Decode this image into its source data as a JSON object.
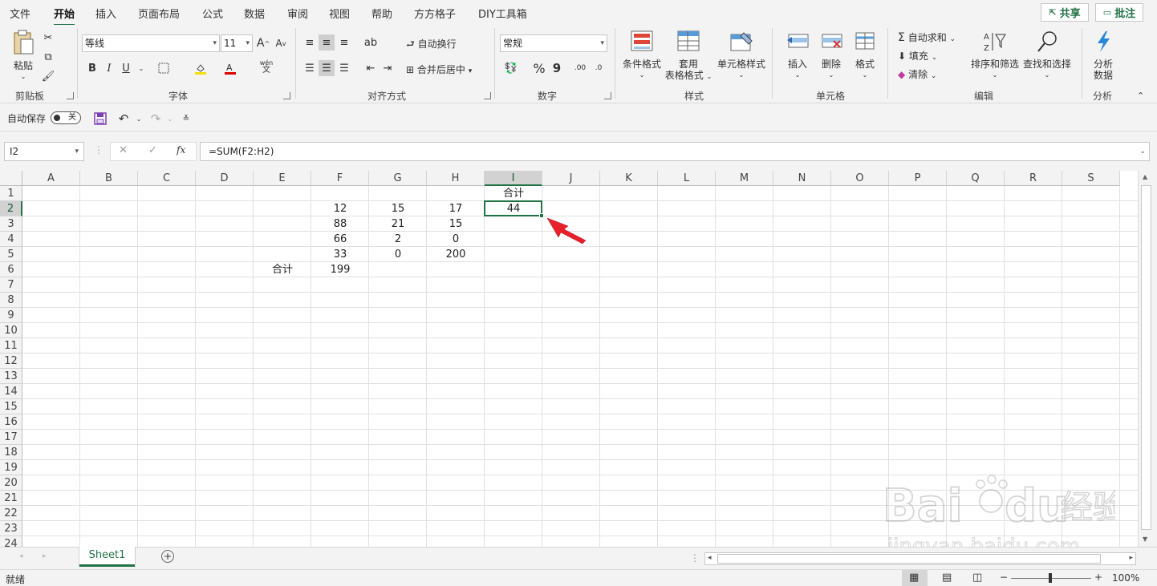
{
  "menu": {
    "tabs": [
      "文件",
      "开始",
      "插入",
      "页面布局",
      "公式",
      "数据",
      "审阅",
      "视图",
      "帮助",
      "方方格子",
      "DIY工具箱"
    ],
    "active_tab": "开始",
    "share": "共享",
    "comment": "批注"
  },
  "ribbon": {
    "clipboard": {
      "paste": "粘贴",
      "label": "剪贴板"
    },
    "font": {
      "name": "等线",
      "size": "11",
      "label": "字体",
      "bold": "B",
      "italic": "I",
      "underline": "U",
      "grow": "A",
      "shrink": "A",
      "phonetic_top": "wén",
      "phonetic_bottom": "文"
    },
    "alignment": {
      "wrap": "自动换行",
      "merge": "合并后居中",
      "label": "对齐方式"
    },
    "number": {
      "format": "常规",
      "label": "数字",
      "percent": "%",
      "comma": "9"
    },
    "styles": {
      "conditional": "条件格式",
      "table_line1": "套用",
      "table_line2": "表格格式",
      "cell_styles": "单元格样式",
      "label": "样式"
    },
    "cells": {
      "insert": "插入",
      "delete": "删除",
      "format": "格式",
      "label": "单元格"
    },
    "editing": {
      "autosum": "自动求和",
      "fill": "填充",
      "clear": "清除",
      "sort": "排序和筛选",
      "find": "查找和选择",
      "label": "编辑"
    },
    "analysis": {
      "btn_line1": "分析",
      "btn_line2": "数据",
      "label": "分析"
    }
  },
  "qat": {
    "autosave": "自动保存",
    "toggle": "关"
  },
  "formula_bar": {
    "name_box": "I2",
    "fx": "fx",
    "formula": "=SUM(F2:H2)"
  },
  "sheet": {
    "columns": [
      "A",
      "B",
      "C",
      "D",
      "E",
      "F",
      "G",
      "H",
      "I",
      "J",
      "K",
      "L",
      "M",
      "N",
      "O",
      "P",
      "Q",
      "R",
      "S"
    ],
    "selected_column": "I",
    "rows": [
      "1",
      "2",
      "3",
      "4",
      "5",
      "6",
      "7",
      "8",
      "9",
      "10",
      "11",
      "12",
      "13",
      "14",
      "15",
      "16",
      "17",
      "18",
      "19",
      "20",
      "21",
      "22",
      "23",
      "24"
    ],
    "selected_row": "2",
    "cells": [
      {
        "ref": "I1",
        "col": 8,
        "row": 0,
        "value": "合计"
      },
      {
        "ref": "F2",
        "col": 5,
        "row": 1,
        "value": "12"
      },
      {
        "ref": "G2",
        "col": 6,
        "row": 1,
        "value": "15"
      },
      {
        "ref": "H2",
        "col": 7,
        "row": 1,
        "value": "17"
      },
      {
        "ref": "I2",
        "col": 8,
        "row": 1,
        "value": "44"
      },
      {
        "ref": "F3",
        "col": 5,
        "row": 2,
        "value": "88"
      },
      {
        "ref": "G3",
        "col": 6,
        "row": 2,
        "value": "21"
      },
      {
        "ref": "H3",
        "col": 7,
        "row": 2,
        "value": "15"
      },
      {
        "ref": "F4",
        "col": 5,
        "row": 3,
        "value": "66"
      },
      {
        "ref": "G4",
        "col": 6,
        "row": 3,
        "value": "2"
      },
      {
        "ref": "H4",
        "col": 7,
        "row": 3,
        "value": "0"
      },
      {
        "ref": "F5",
        "col": 5,
        "row": 4,
        "value": "33"
      },
      {
        "ref": "G5",
        "col": 6,
        "row": 4,
        "value": "0"
      },
      {
        "ref": "H5",
        "col": 7,
        "row": 4,
        "value": "200"
      },
      {
        "ref": "E6",
        "col": 4,
        "row": 5,
        "value": "合计"
      },
      {
        "ref": "F6",
        "col": 5,
        "row": 5,
        "value": "199"
      }
    ],
    "active_sheet": "Sheet1"
  },
  "status": {
    "ready": "就绪",
    "zoom": "100%"
  },
  "watermark": {
    "brand": "Baidu",
    "cn": "经验",
    "url": "jingyan.baidu.com"
  },
  "colors": {
    "accent": "#217346",
    "arrow": "#e8202a"
  }
}
